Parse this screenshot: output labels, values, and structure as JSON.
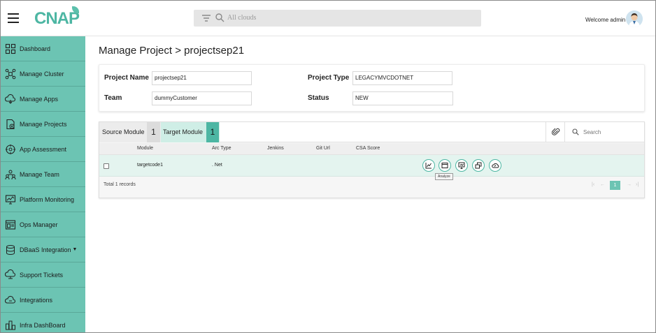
{
  "header": {
    "logo": "CNAP",
    "search_placeholder": "All clouds",
    "welcome": "Welcome admin"
  },
  "sidebar": {
    "items": [
      {
        "label": "Dashboard",
        "icon": "dashboard-icon"
      },
      {
        "label": "Manage Cluster",
        "icon": "cluster-icon"
      },
      {
        "label": "Manage Apps",
        "icon": "apps-icon"
      },
      {
        "label": "Manage Projects",
        "icon": "projects-icon"
      },
      {
        "label": "App Assessment",
        "icon": "assessment-icon"
      },
      {
        "label": "Manage Team",
        "icon": "team-icon"
      },
      {
        "label": "Platform Monitoring",
        "icon": "monitoring-icon"
      },
      {
        "label": "Ops Manager",
        "icon": "ops-icon"
      },
      {
        "label": "DBaaS Integration",
        "icon": "database-icon"
      },
      {
        "label": "Support Tickets",
        "icon": "tickets-icon"
      },
      {
        "label": "Integrations",
        "icon": "cloud-icon"
      },
      {
        "label": "Infra DashBoard",
        "icon": "infra-icon"
      }
    ]
  },
  "page": {
    "breadcrumb": "Manage Project > projectsep21"
  },
  "project": {
    "name_label": "Project Name",
    "name_value": "projectsep21",
    "type_label": "Project Type",
    "type_value": "LEGACYMVCDOTNET",
    "team_label": "Team",
    "team_value": "dummyCustomer",
    "status_label": "Status",
    "status_value": "NEW"
  },
  "modules": {
    "source_label": "Source Module",
    "source_count": "1",
    "target_label": "Target Module",
    "target_count": "1",
    "search_placeholder": "Search",
    "columns": [
      "Module",
      "Arc Type",
      "Jenkins",
      "Git Url",
      "CSA Score"
    ],
    "rows": [
      {
        "module": "targetcode1",
        "arc_type": ". Net",
        "jenkins": "",
        "git_url": "",
        "csa_score": ""
      }
    ],
    "tooltip": "Analyze",
    "total": "Total 1 records",
    "current_page": "1"
  },
  "colors": {
    "accent": "#6cc4b3",
    "accent_dark": "#4db6a3",
    "row_highlight": "#e4f4ef"
  }
}
